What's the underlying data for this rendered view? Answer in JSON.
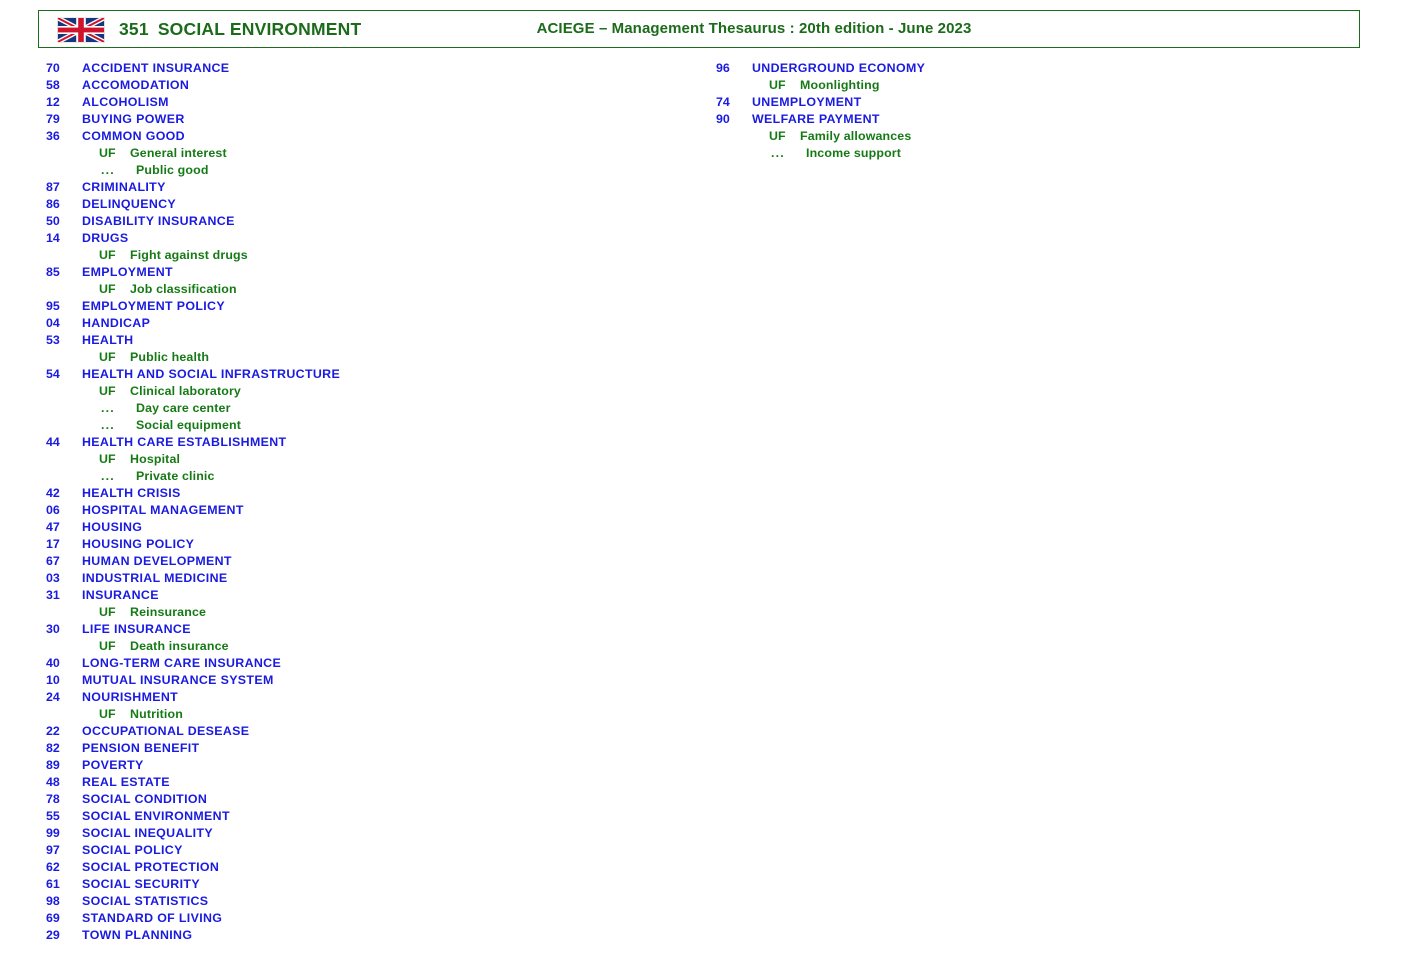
{
  "header": {
    "flag_icon": "uk-flag-icon",
    "code": "351",
    "title": "SOCIAL ENVIRONMENT",
    "source": "ACIEGE  –  Management Thesaurus  :   20th edition  -  June 2023"
  },
  "colors": {
    "descriptor": "#1a1ae0",
    "non_descriptor": "#157a15",
    "header_text": "#1b6b1b",
    "header_border": "#1d6b1d",
    "background": "#ffffff"
  },
  "relation_markers": {
    "uf": "UF",
    "continuation": "..."
  },
  "columns": {
    "left": [
      {
        "kind": "term",
        "code": "70",
        "label": "ACCIDENT INSURANCE"
      },
      {
        "kind": "term",
        "code": "58",
        "label": "ACCOMODATION"
      },
      {
        "kind": "term",
        "code": "12",
        "label": "ALCOHOLISM"
      },
      {
        "kind": "term",
        "code": "79",
        "label": "BUYING POWER"
      },
      {
        "kind": "term",
        "code": "36",
        "label": "COMMON GOOD"
      },
      {
        "kind": "uf",
        "code": "UF",
        "label": "General interest"
      },
      {
        "kind": "cont",
        "code": "...",
        "label": "Public good"
      },
      {
        "kind": "term",
        "code": "87",
        "label": "CRIMINALITY"
      },
      {
        "kind": "term",
        "code": "86",
        "label": "DELINQUENCY"
      },
      {
        "kind": "term",
        "code": "50",
        "label": "DISABILITY INSURANCE"
      },
      {
        "kind": "term",
        "code": "14",
        "label": "DRUGS"
      },
      {
        "kind": "uf",
        "code": "UF",
        "label": "Fight against drugs"
      },
      {
        "kind": "term",
        "code": "85",
        "label": "EMPLOYMENT"
      },
      {
        "kind": "uf",
        "code": "UF",
        "label": "Job classification"
      },
      {
        "kind": "term",
        "code": "95",
        "label": "EMPLOYMENT POLICY"
      },
      {
        "kind": "term",
        "code": "04",
        "label": "HANDICAP"
      },
      {
        "kind": "term",
        "code": "53",
        "label": "HEALTH"
      },
      {
        "kind": "uf",
        "code": "UF",
        "label": "Public health"
      },
      {
        "kind": "term",
        "code": "54",
        "label": "HEALTH AND SOCIAL INFRASTRUCTURE"
      },
      {
        "kind": "uf",
        "code": "UF",
        "label": "Clinical laboratory"
      },
      {
        "kind": "cont",
        "code": "...",
        "label": "Day care center"
      },
      {
        "kind": "cont",
        "code": "...",
        "label": "Social equipment"
      },
      {
        "kind": "term",
        "code": "44",
        "label": "HEALTH CARE ESTABLISHMENT"
      },
      {
        "kind": "uf",
        "code": "UF",
        "label": "Hospital"
      },
      {
        "kind": "cont",
        "code": "...",
        "label": "Private clinic"
      },
      {
        "kind": "term",
        "code": "42",
        "label": "HEALTH CRISIS"
      },
      {
        "kind": "term",
        "code": "06",
        "label": "HOSPITAL MANAGEMENT"
      },
      {
        "kind": "term",
        "code": "47",
        "label": "HOUSING"
      },
      {
        "kind": "term",
        "code": "17",
        "label": "HOUSING POLICY"
      },
      {
        "kind": "term",
        "code": "67",
        "label": "HUMAN DEVELOPMENT"
      },
      {
        "kind": "term",
        "code": "03",
        "label": "INDUSTRIAL MEDICINE"
      },
      {
        "kind": "term",
        "code": "31",
        "label": "INSURANCE"
      },
      {
        "kind": "uf",
        "code": "UF",
        "label": "Reinsurance"
      },
      {
        "kind": "term",
        "code": "30",
        "label": "LIFE INSURANCE"
      },
      {
        "kind": "uf",
        "code": "UF",
        "label": "Death insurance"
      },
      {
        "kind": "term",
        "code": "40",
        "label": "LONG-TERM CARE INSURANCE"
      },
      {
        "kind": "term",
        "code": "10",
        "label": "MUTUAL INSURANCE SYSTEM"
      },
      {
        "kind": "term",
        "code": "24",
        "label": "NOURISHMENT"
      },
      {
        "kind": "uf",
        "code": "UF",
        "label": "Nutrition"
      },
      {
        "kind": "term",
        "code": "22",
        "label": "OCCUPATIONAL DESEASE"
      },
      {
        "kind": "term",
        "code": "82",
        "label": "PENSION BENEFIT"
      },
      {
        "kind": "term",
        "code": "89",
        "label": "POVERTY"
      },
      {
        "kind": "term",
        "code": "48",
        "label": "REAL ESTATE"
      },
      {
        "kind": "term",
        "code": "78",
        "label": "SOCIAL CONDITION"
      },
      {
        "kind": "term",
        "code": "55",
        "label": "SOCIAL ENVIRONMENT"
      },
      {
        "kind": "term",
        "code": "99",
        "label": "SOCIAL INEQUALITY"
      },
      {
        "kind": "term",
        "code": "97",
        "label": "SOCIAL POLICY"
      },
      {
        "kind": "term",
        "code": "62",
        "label": "SOCIAL PROTECTION"
      },
      {
        "kind": "term",
        "code": "61",
        "label": "SOCIAL SECURITY"
      },
      {
        "kind": "term",
        "code": "98",
        "label": "SOCIAL STATISTICS"
      },
      {
        "kind": "term",
        "code": "69",
        "label": "STANDARD OF LIVING"
      },
      {
        "kind": "term",
        "code": "29",
        "label": "TOWN PLANNING"
      }
    ],
    "right": [
      {
        "kind": "term",
        "code": "96",
        "label": "UNDERGROUND  ECONOMY"
      },
      {
        "kind": "uf",
        "code": "UF",
        "label": "Moonlighting"
      },
      {
        "kind": "term",
        "code": "74",
        "label": "UNEMPLOYMENT"
      },
      {
        "kind": "term",
        "code": "90",
        "label": "WELFARE PAYMENT"
      },
      {
        "kind": "uf",
        "code": "UF",
        "label": "Family allowances"
      },
      {
        "kind": "cont",
        "code": "...",
        "label": "Income support"
      }
    ]
  }
}
